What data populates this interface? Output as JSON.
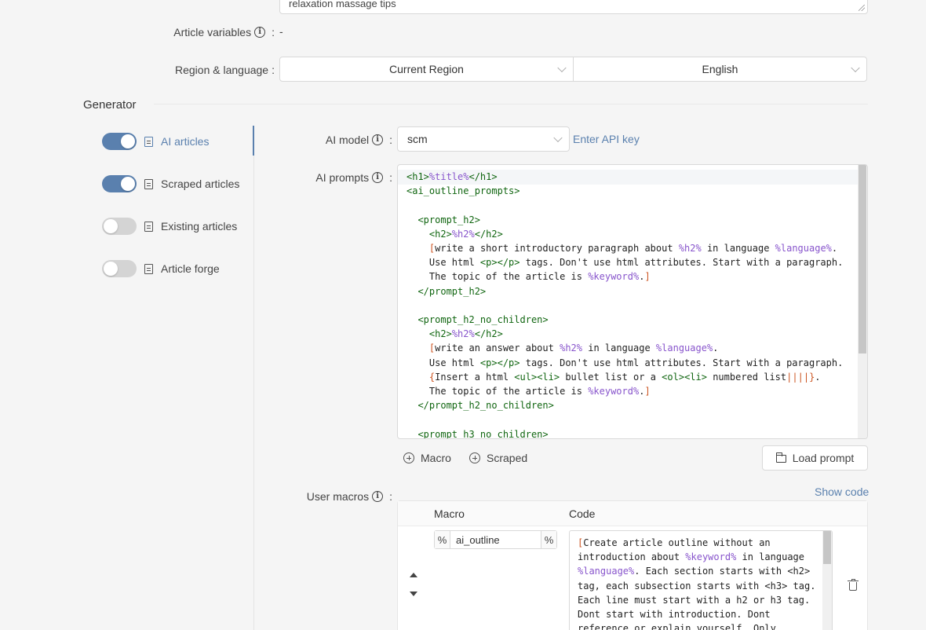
{
  "keywords_field": {
    "value": "relaxation massage tips"
  },
  "article_variables": {
    "label": "Article variables",
    "value": "-"
  },
  "region_language": {
    "label": "Region & language",
    "region": "Current Region",
    "language": "English"
  },
  "generator": {
    "title": "Generator",
    "items": [
      {
        "label": "AI articles",
        "enabled": true,
        "active": true,
        "icon": "robot-icon"
      },
      {
        "label": "Scraped articles",
        "enabled": true,
        "active": false,
        "icon": "copy-icon"
      },
      {
        "label": "Existing articles",
        "enabled": false,
        "active": false,
        "icon": "document-icon"
      },
      {
        "label": "Article forge",
        "enabled": false,
        "active": false,
        "icon": "document-icon"
      }
    ]
  },
  "ai_model": {
    "label": "AI model",
    "value": "scm",
    "api_key_link": "Enter API key"
  },
  "ai_prompts": {
    "label": "AI prompts",
    "lines": [
      "<h1>%title%</h1>",
      "<ai_outline_prompts>",
      "",
      "  <prompt_h2>",
      "    <h2>%h2%</h2>",
      "    [write a short introductory paragraph about %h2% in language %language%.",
      "    Use html <p></p> tags. Don't use html attributes. Start with a paragraph.",
      "    The topic of the article is %keyword%.]",
      "  </prompt_h2>",
      "",
      "  <prompt_h2_no_children>",
      "    <h2>%h2%</h2>",
      "    [write an answer about %h2% in language %language%.",
      "    Use html <p></p> tags. Don't use html attributes. Start with a paragraph.",
      "    {Insert a html <ul><li> bullet list or a <ol><li> numbered list||||}.",
      "    The topic of the article is %keyword%.]",
      "  </prompt_h2_no_children>",
      "",
      "  <prompt_h3_no_children>"
    ],
    "macro_button": "Macro",
    "scraped_button": "Scraped",
    "load_prompt_button": "Load prompt"
  },
  "user_macros": {
    "label": "User macros",
    "show_code_link": "Show code",
    "columns": {
      "macro": "Macro",
      "code": "Code"
    },
    "rows": [
      {
        "prefix": "%",
        "name": "ai_outline",
        "suffix": "%",
        "code_lines": [
          "[Create article outline without an",
          "introduction about %keyword% in language",
          "%language%. Each section starts with <h2>",
          "tag, each subsection starts with <h3> tag.",
          "Each line must start with a h2 or h3 tag.",
          "Dont start with introduction. Dont",
          "reference or explain yourself. Only"
        ]
      }
    ]
  },
  "colors": {
    "accent": "#5a80ae",
    "tag": "#116611",
    "variable": "#8855cc",
    "bracket": "#cc5522"
  }
}
